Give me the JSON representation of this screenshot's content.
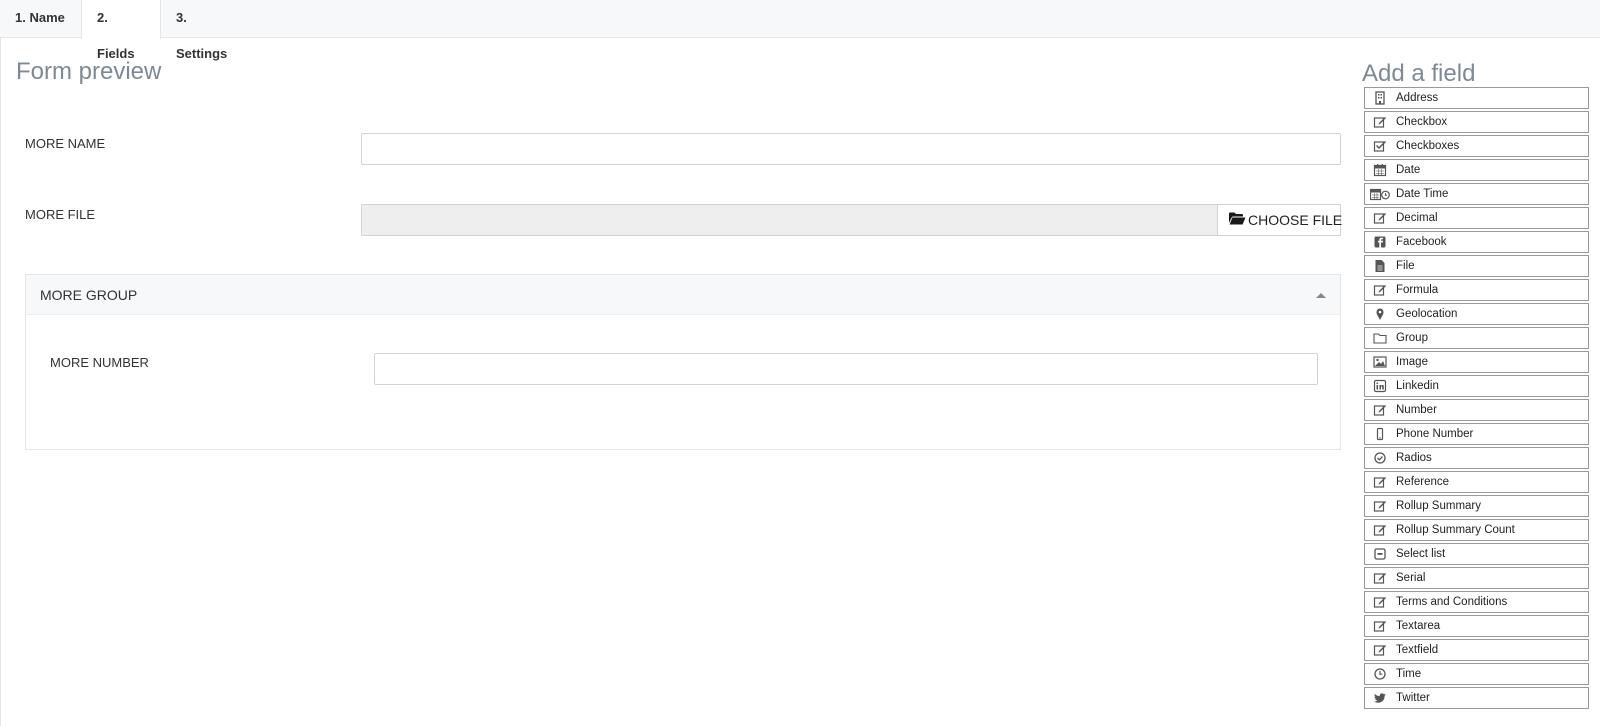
{
  "tabs": [
    {
      "label": "1. Name"
    },
    {
      "label": "2. Fields"
    },
    {
      "label": "3. Settings"
    }
  ],
  "preview": {
    "title": "Form preview",
    "fields": {
      "name_label": "MORE NAME",
      "name_value": "",
      "file_label": "MORE FILE",
      "choose_file_label": "CHOOSE FILE",
      "group_title": "MORE GROUP",
      "number_label": "MORE NUMBER",
      "number_value": ""
    }
  },
  "add_field": {
    "title": "Add a field",
    "items": [
      {
        "label": "Address",
        "icon": "address-icon"
      },
      {
        "label": "Checkbox",
        "icon": "edit-icon"
      },
      {
        "label": "Checkboxes",
        "icon": "checked-box-icon"
      },
      {
        "label": "Date",
        "icon": "calendar-icon"
      },
      {
        "label": "Date Time",
        "icon": "calendar-clock-icon"
      },
      {
        "label": "Decimal",
        "icon": "edit-icon"
      },
      {
        "label": "Facebook",
        "icon": "facebook-icon"
      },
      {
        "label": "File",
        "icon": "file-icon"
      },
      {
        "label": "Formula",
        "icon": "edit-icon"
      },
      {
        "label": "Geolocation",
        "icon": "map-pin-icon"
      },
      {
        "label": "Group",
        "icon": "folder-icon"
      },
      {
        "label": "Image",
        "icon": "image-icon"
      },
      {
        "label": "Linkedin",
        "icon": "linkedin-icon"
      },
      {
        "label": "Number",
        "icon": "edit-icon"
      },
      {
        "label": "Phone Number",
        "icon": "mobile-icon"
      },
      {
        "label": "Radios",
        "icon": "radio-check-icon"
      },
      {
        "label": "Reference",
        "icon": "edit-icon"
      },
      {
        "label": "Rollup Summary",
        "icon": "edit-icon"
      },
      {
        "label": "Rollup Summary Count",
        "icon": "edit-icon"
      },
      {
        "label": "Select list",
        "icon": "select-list-icon"
      },
      {
        "label": "Serial",
        "icon": "edit-icon"
      },
      {
        "label": "Terms and Conditions",
        "icon": "edit-icon"
      },
      {
        "label": "Textarea",
        "icon": "edit-icon"
      },
      {
        "label": "Textfield",
        "icon": "edit-icon"
      },
      {
        "label": "Time",
        "icon": "clock-icon"
      },
      {
        "label": "Twitter",
        "icon": "twitter-icon"
      }
    ]
  }
}
